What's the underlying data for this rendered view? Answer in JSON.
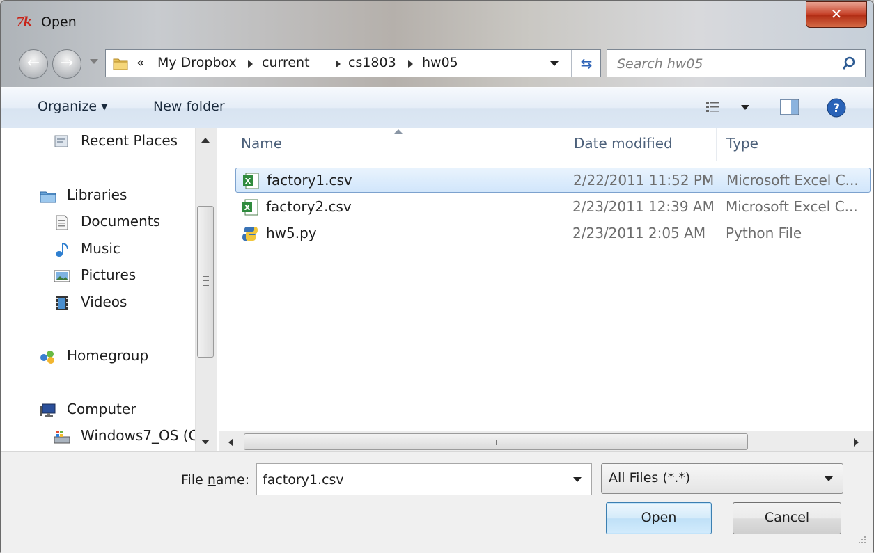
{
  "window": {
    "title": "Open",
    "app_logo_text": "7k"
  },
  "address": {
    "overflow": "«",
    "crumbs": [
      "My Dropbox",
      "current",
      "cs1803",
      "hw05"
    ]
  },
  "search": {
    "placeholder": "Search hw05"
  },
  "toolbar": {
    "organize_label": "Organize ▾",
    "new_folder_label": "New folder"
  },
  "nav": {
    "recent_places": "Recent Places",
    "libraries": "Libraries",
    "documents": "Documents",
    "music": "Music",
    "pictures": "Pictures",
    "videos": "Videos",
    "homegroup": "Homegroup",
    "computer": "Computer",
    "windows7_os": "Windows7_OS (C"
  },
  "columns": {
    "name": "Name",
    "date": "Date modified",
    "type": "Type"
  },
  "files": [
    {
      "name": "factory1.csv",
      "date": "2/22/2011 11:52 PM",
      "type": "Microsoft Excel C...",
      "icon": "excel-csv-icon",
      "selected": true
    },
    {
      "name": "factory2.csv",
      "date": "2/23/2011 12:39 AM",
      "type": "Microsoft Excel C...",
      "icon": "excel-csv-icon",
      "selected": false
    },
    {
      "name": "hw5.py",
      "date": "2/23/2011 2:05 AM",
      "type": "Python File",
      "icon": "python-file-icon",
      "selected": false
    }
  ],
  "bottom": {
    "file_name_label_pre": "File ",
    "file_name_label_u": "n",
    "file_name_label_post": "ame:",
    "file_name_value": "factory1.csv",
    "file_type_value": "All Files (*.*)",
    "open_label": "Open",
    "cancel_label": "Cancel"
  },
  "colors": {
    "accent": "#3c7fb1",
    "selection": "#d1e6fb",
    "header_text": "#4c607a"
  }
}
